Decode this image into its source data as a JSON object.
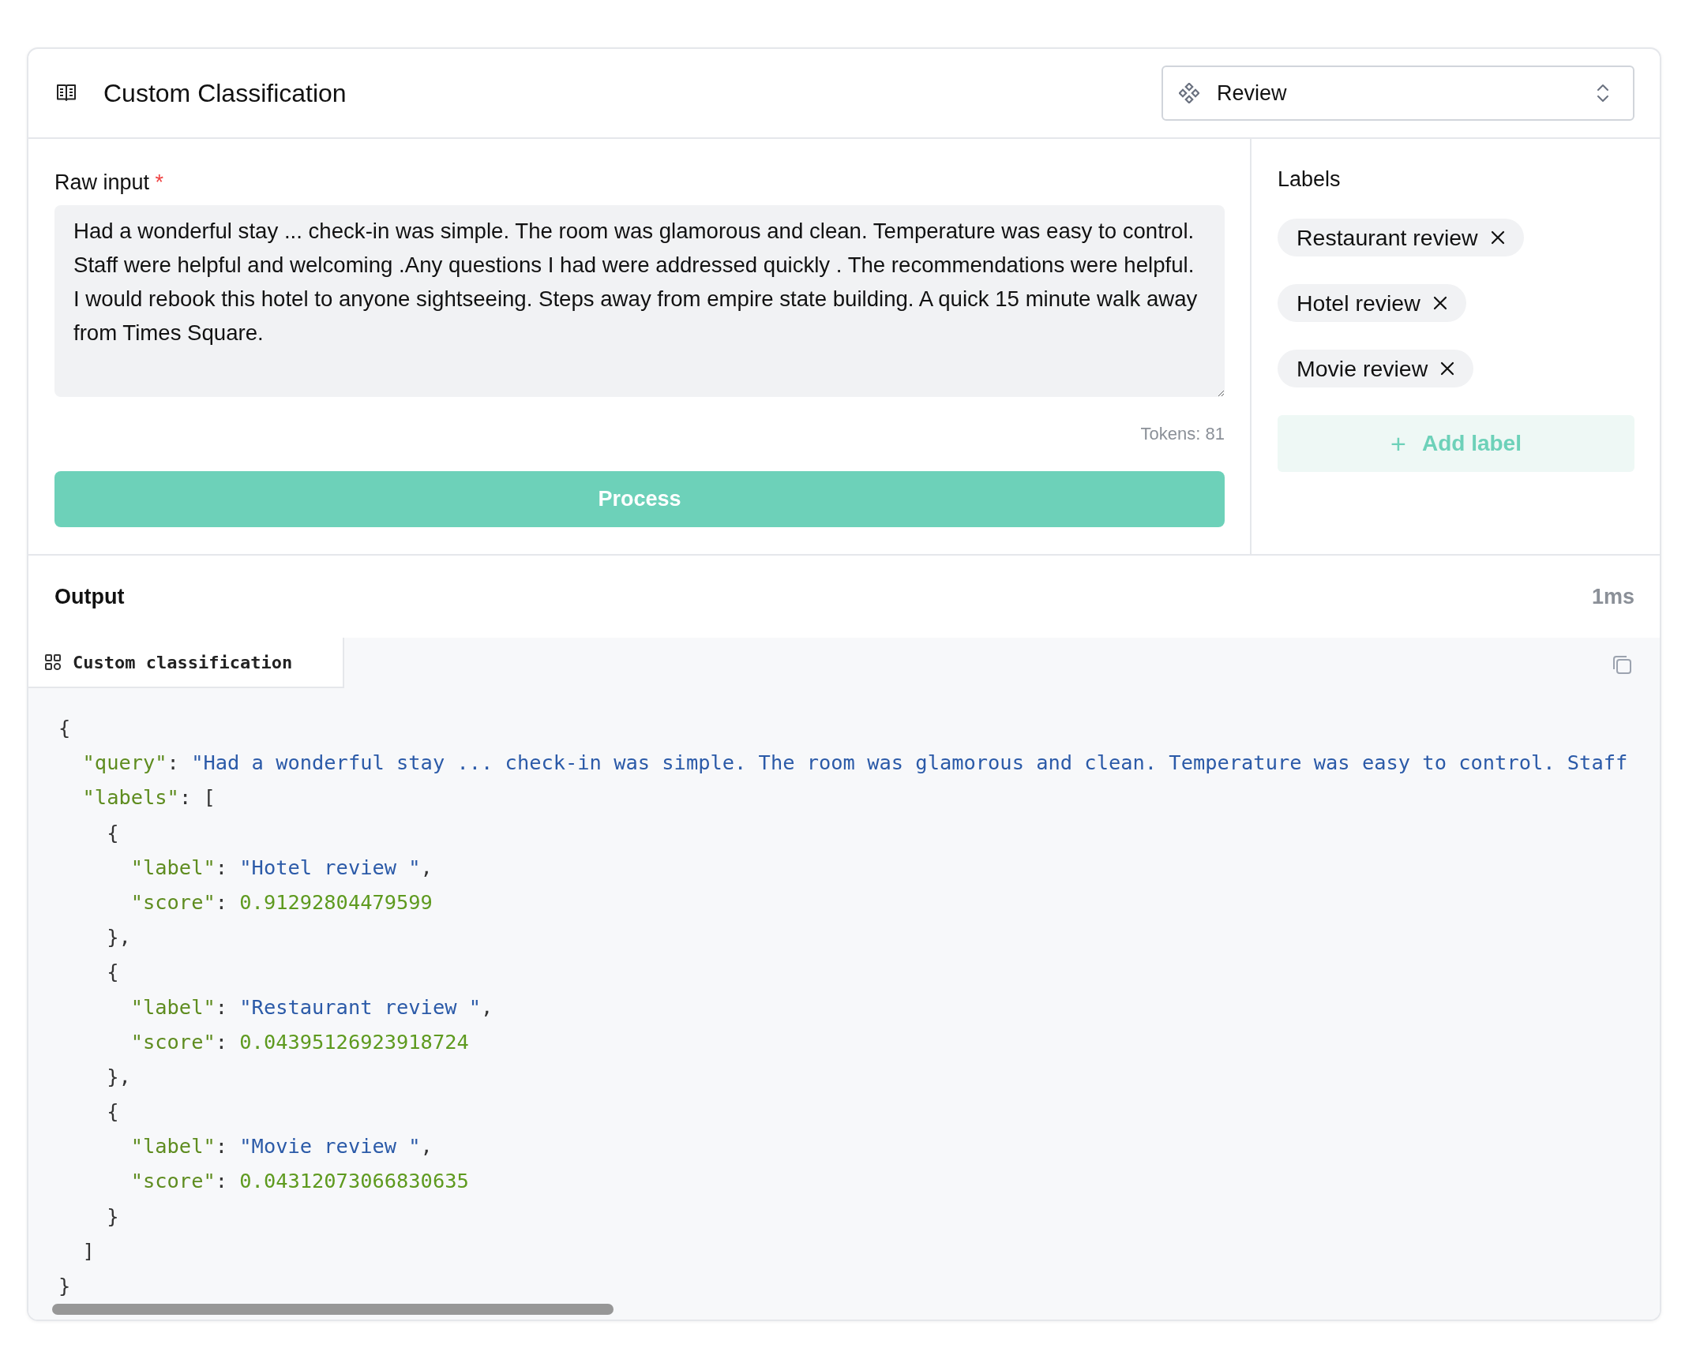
{
  "header": {
    "title": "Custom Classification",
    "select": {
      "value": "Review"
    }
  },
  "input": {
    "label": "Raw input",
    "required_mark": "*",
    "value": "Had a wonderful stay ... check-in was simple. The room was glamorous and clean. Temperature was easy to control. Staff were helpful and welcoming .Any questions I had were addressed quickly . The recommendations were helpful. I would rebook this hotel to anyone sightseeing. Steps away from empire state building. A quick 15 minute walk away from Times Square.",
    "tokens": "Tokens: 81",
    "button": {
      "label": "Process",
      "disabled": true
    }
  },
  "labels": {
    "title": "Labels",
    "items": [
      {
        "text": "Restaurant review"
      },
      {
        "text": "Hotel review"
      },
      {
        "text": "Movie review"
      }
    ],
    "add_button": {
      "icon": "+",
      "label": "Add label"
    }
  },
  "output": {
    "title": "Output",
    "duration": "1ms",
    "tabs": [
      {
        "label": "Custom classification",
        "selected": true
      }
    ],
    "code_lines": [
      [
        {
          "kind": "punct",
          "text": "{"
        }
      ],
      [
        {
          "kind": "key",
          "text": "  \"query\""
        },
        {
          "kind": "punct",
          "text": ": "
        },
        {
          "kind": "string",
          "text": "\"Had a wonderful stay ... check-in was simple. The room was glamorous and clean. Temperature was easy to control. Staff"
        }
      ],
      [
        {
          "kind": "key",
          "text": "  \"labels\""
        },
        {
          "kind": "punct",
          "text": ": ["
        }
      ],
      [
        {
          "kind": "punct",
          "text": "    {"
        }
      ],
      [
        {
          "kind": "key",
          "text": "      \"label\""
        },
        {
          "kind": "punct",
          "text": ": "
        },
        {
          "kind": "string",
          "text": "\"Hotel review \""
        },
        {
          "kind": "punct",
          "text": ","
        }
      ],
      [
        {
          "kind": "key",
          "text": "      \"score\""
        },
        {
          "kind": "punct",
          "text": ": "
        },
        {
          "kind": "number",
          "text": "0.91292804479599"
        }
      ],
      [
        {
          "kind": "punct",
          "text": "    },"
        }
      ],
      [
        {
          "kind": "punct",
          "text": "    {"
        }
      ],
      [
        {
          "kind": "key",
          "text": "      \"label\""
        },
        {
          "kind": "punct",
          "text": ": "
        },
        {
          "kind": "string",
          "text": "\"Restaurant review \""
        },
        {
          "kind": "punct",
          "text": ","
        }
      ],
      [
        {
          "kind": "key",
          "text": "      \"score\""
        },
        {
          "kind": "punct",
          "text": ": "
        },
        {
          "kind": "number",
          "text": "0.04395126923918724"
        }
      ],
      [
        {
          "kind": "punct",
          "text": "    },"
        }
      ],
      [
        {
          "kind": "punct",
          "text": "    {"
        }
      ],
      [
        {
          "kind": "key",
          "text": "      \"label\""
        },
        {
          "kind": "punct",
          "text": ": "
        },
        {
          "kind": "string",
          "text": "\"Movie review \""
        },
        {
          "kind": "punct",
          "text": ","
        }
      ],
      [
        {
          "kind": "key",
          "text": "      \"score\""
        },
        {
          "kind": "punct",
          "text": ": "
        },
        {
          "kind": "number",
          "text": "0.04312073066830635"
        }
      ],
      [
        {
          "kind": "punct",
          "text": "    }"
        }
      ],
      [
        {
          "kind": "punct",
          "text": "  ]"
        }
      ],
      [
        {
          "kind": "punct",
          "text": "}"
        }
      ]
    ]
  }
}
